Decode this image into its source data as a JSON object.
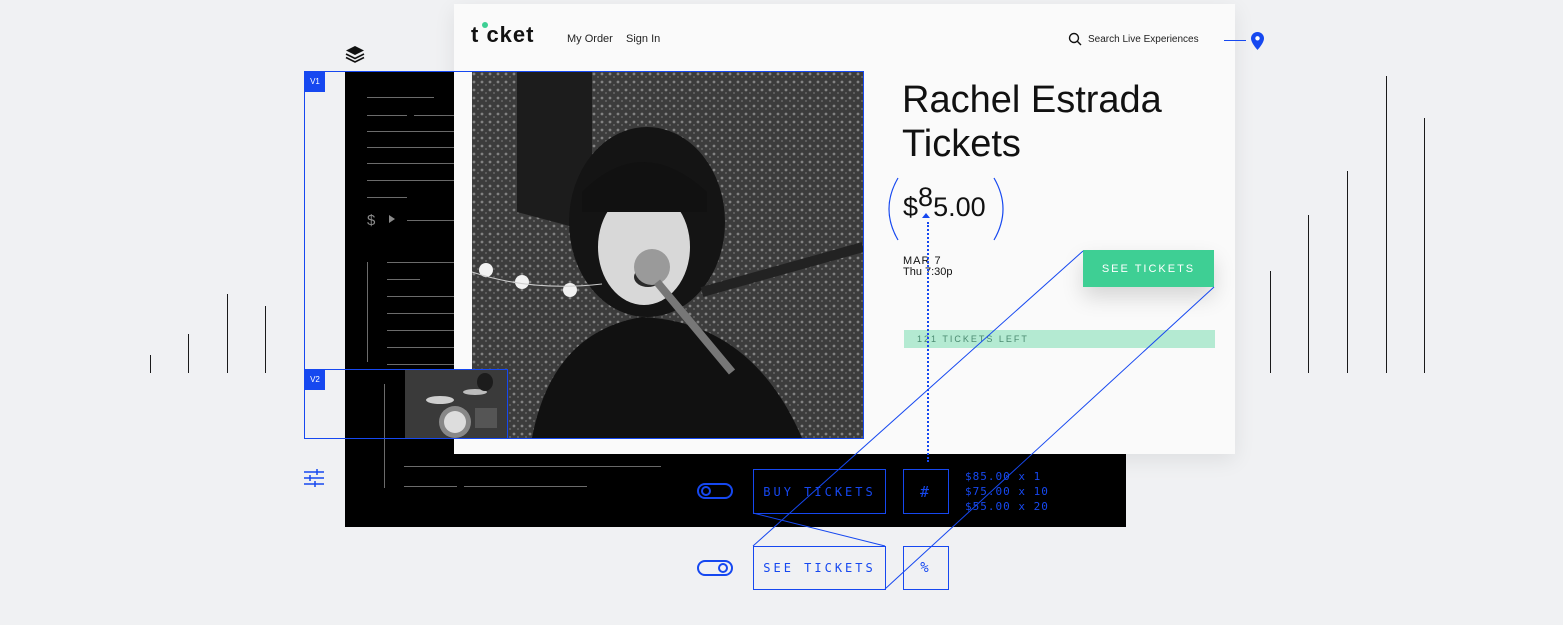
{
  "brand": {
    "logo_text": "t cket",
    "logo_dot_color": "#3ecf94"
  },
  "nav": {
    "my_order": "My Order",
    "sign_in": "Sign In"
  },
  "search": {
    "label": "Search Live Experiences"
  },
  "event": {
    "title_line1": "Rachel Estrada",
    "title_line2": "Tickets",
    "price_currency": "$",
    "price_digit": "8",
    "price_rest": "5.00",
    "date": "MAR 7",
    "time": "Thu 7:30p",
    "see_tickets": "SEE TICKETS",
    "tickets_left": "121 TICKETS LEFT"
  },
  "wireframe": {
    "v1_tag": "V1",
    "v2_tag": "V2",
    "currency_glyph": "$",
    "buy_tickets": "BUY TICKETS",
    "see_tickets": "SEE TICKETS",
    "hash": "#",
    "percent": "%",
    "price_options": [
      "$85.00 x 1",
      "$75.00 x 10",
      "$55.00 x 20"
    ]
  },
  "colors": {
    "accent_green": "#3ecf94",
    "light_green": "#b4ead2",
    "wire_blue": "#1648f0"
  },
  "icons": [
    "layers-icon",
    "search-icon",
    "location-pin-icon",
    "sliders-icon",
    "toggle-icon"
  ]
}
